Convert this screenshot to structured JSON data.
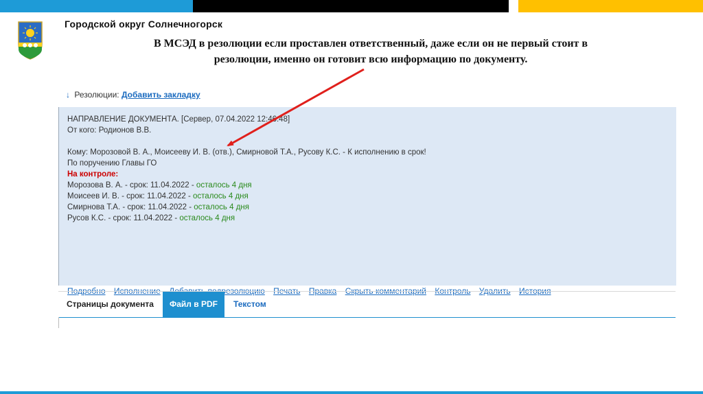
{
  "header": {
    "org_name": "Городской округ Солнечногорск",
    "headline_line1": "В МСЭД в резолюции если проставлен ответственный, даже если он не первый стоит в",
    "headline_line2": "резолюции, именно он готовит всю информацию по документу."
  },
  "resolutions": {
    "arrow": "↓",
    "label": "Резолюции:",
    "add_bookmark": "Добавить закладку",
    "lines": {
      "direction": "НАПРАВЛЕНИЕ ДОКУМЕНТА. [Сервер, 07.04.2022 12:46:48]",
      "from": "От кого: Родионов В.В.",
      "to": "Кому: Морозовой В. А., Моисееву И. В. (отв.), Смирновой Т.А., Русову К.С. - К исполнению в срок!",
      "instruction": "По поручению Главы ГО",
      "control_title": "На контроле:"
    },
    "control_items": [
      {
        "person": "Морозова В. А. - срок: 11.04.2022 - ",
        "remaining": "осталось 4 дня"
      },
      {
        "person": "Моисеев И. В. - срок: 11.04.2022 - ",
        "remaining": "осталось 4 дня"
      },
      {
        "person": "Смирнова Т.А. - срок: 11.04.2022 - ",
        "remaining": "осталось 4 дня"
      },
      {
        "person": "Русов К.С. - срок: 11.04.2022 - ",
        "remaining": "осталось 4 дня"
      }
    ],
    "actions": [
      "Подробно",
      "Исполнение",
      "Добавить подрезолюцию",
      "Печать",
      "Правка",
      "Скрыть комментарий",
      "Контроль",
      "Удалить",
      "История"
    ]
  },
  "tabs": {
    "pages": "Страницы документа",
    "pdf": "Файл в PDF",
    "text": "Текстом"
  },
  "colors": {
    "accent_blue": "#1e9bd7",
    "accent_yellow": "#ffc000",
    "arrow_red": "#e0201c",
    "panel_bg": "#dde8f5"
  },
  "icons": [
    "coat-of-arms-icon",
    "down-arrow-icon",
    "red-pointer-arrow-icon"
  ]
}
